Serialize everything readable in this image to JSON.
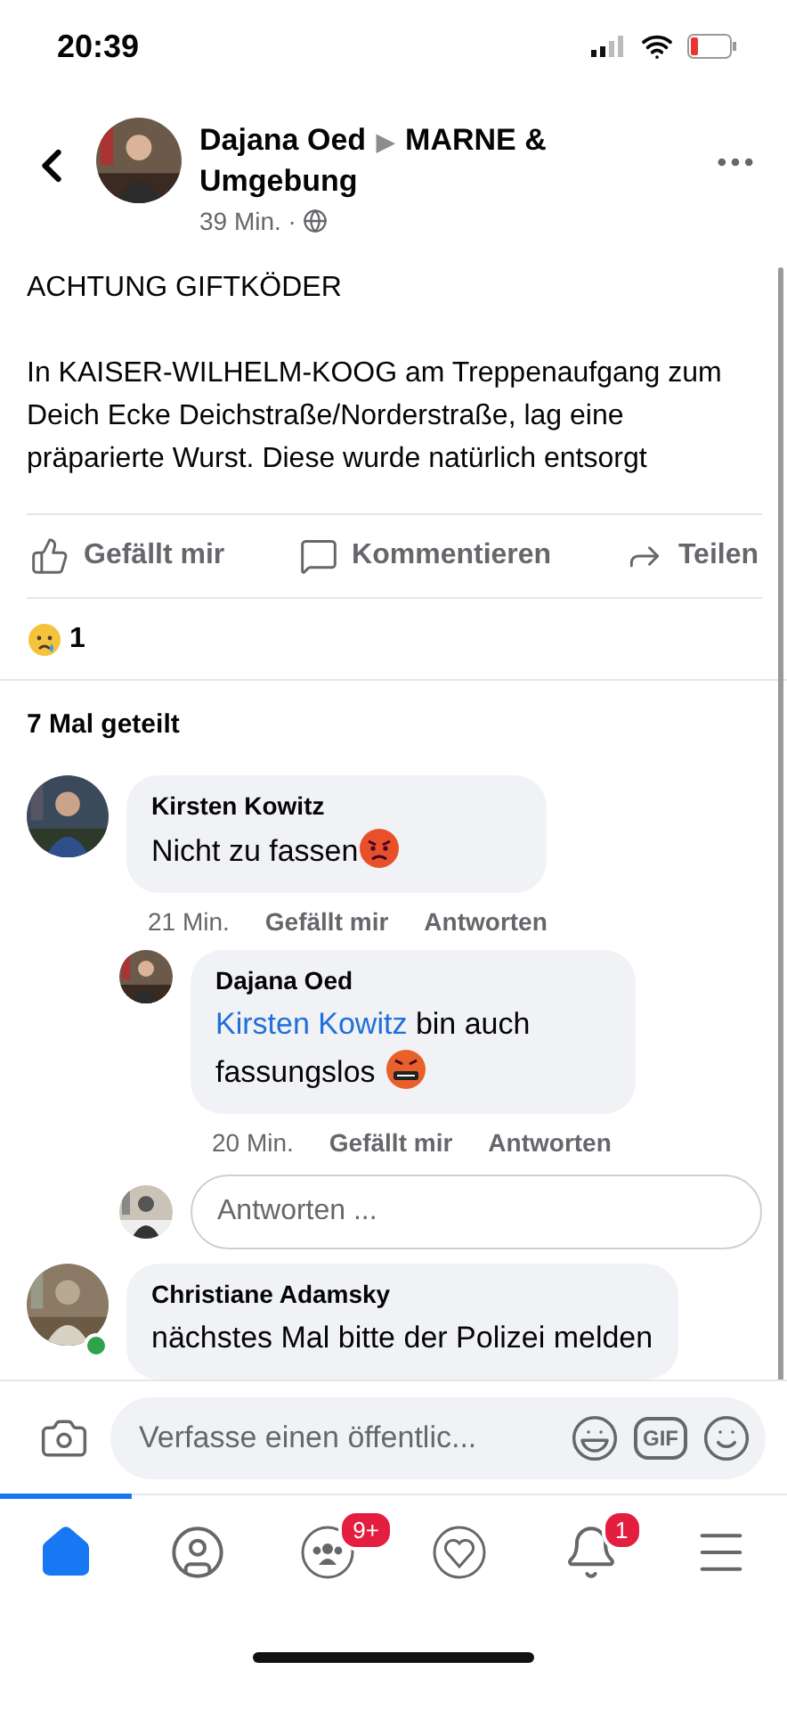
{
  "status_bar": {
    "time": "20:39"
  },
  "header": {
    "author": "Dajana Oed",
    "arrow": "▶",
    "group": "MARNE & Umgebung",
    "meta": "39 Min. ·"
  },
  "post": {
    "title": "ACHTUNG GIFTKÖDER",
    "body": "In KAISER-WILHELM-KOOG am Treppenaufgang zum Deich Ecke Deichstraße/Norderstraße, lag eine präparierte Wurst. Diese wurde natürlich entsorgt"
  },
  "actions": [
    {
      "kind": "like",
      "label": "Gefällt mir"
    },
    {
      "kind": "comment",
      "label": "Kommentieren"
    },
    {
      "kind": "share",
      "label": "Teilen"
    }
  ],
  "reactions": {
    "count": "1"
  },
  "shares": "7 Mal geteilt",
  "comments": [
    {
      "author": "Kirsten Kowitz",
      "text": "Nicht zu fassen",
      "kind": "angry",
      "time": "21 Min.",
      "like": "Gefällt mir",
      "reply": "Antworten",
      "online": false,
      "reply_placeholder": "Antworten ...",
      "children": [
        {
          "author": "Dajana Oed",
          "mention": "Kirsten Kowitz",
          "text": "bin auch fassungslos",
          "kind": "cursing",
          "time": "20 Min.",
          "like": "Gefällt mir",
          "reply": "Antworten",
          "online": false
        }
      ]
    },
    {
      "author": "Christiane Adamsky",
      "text": "nächstes Mal bitte der Polizei melden",
      "online": true
    }
  ],
  "composer": {
    "placeholder": "Verfasse einen öffentlic...",
    "gif": "GIF"
  },
  "tabs": [
    {
      "kind": "home",
      "selected": true
    },
    {
      "kind": "profile",
      "selected": false
    },
    {
      "kind": "groups",
      "selected": false,
      "badge": "9+"
    },
    {
      "kind": "dating",
      "selected": false
    },
    {
      "kind": "notifications",
      "selected": false,
      "badge": "1"
    },
    {
      "kind": "menu",
      "selected": false
    }
  ]
}
